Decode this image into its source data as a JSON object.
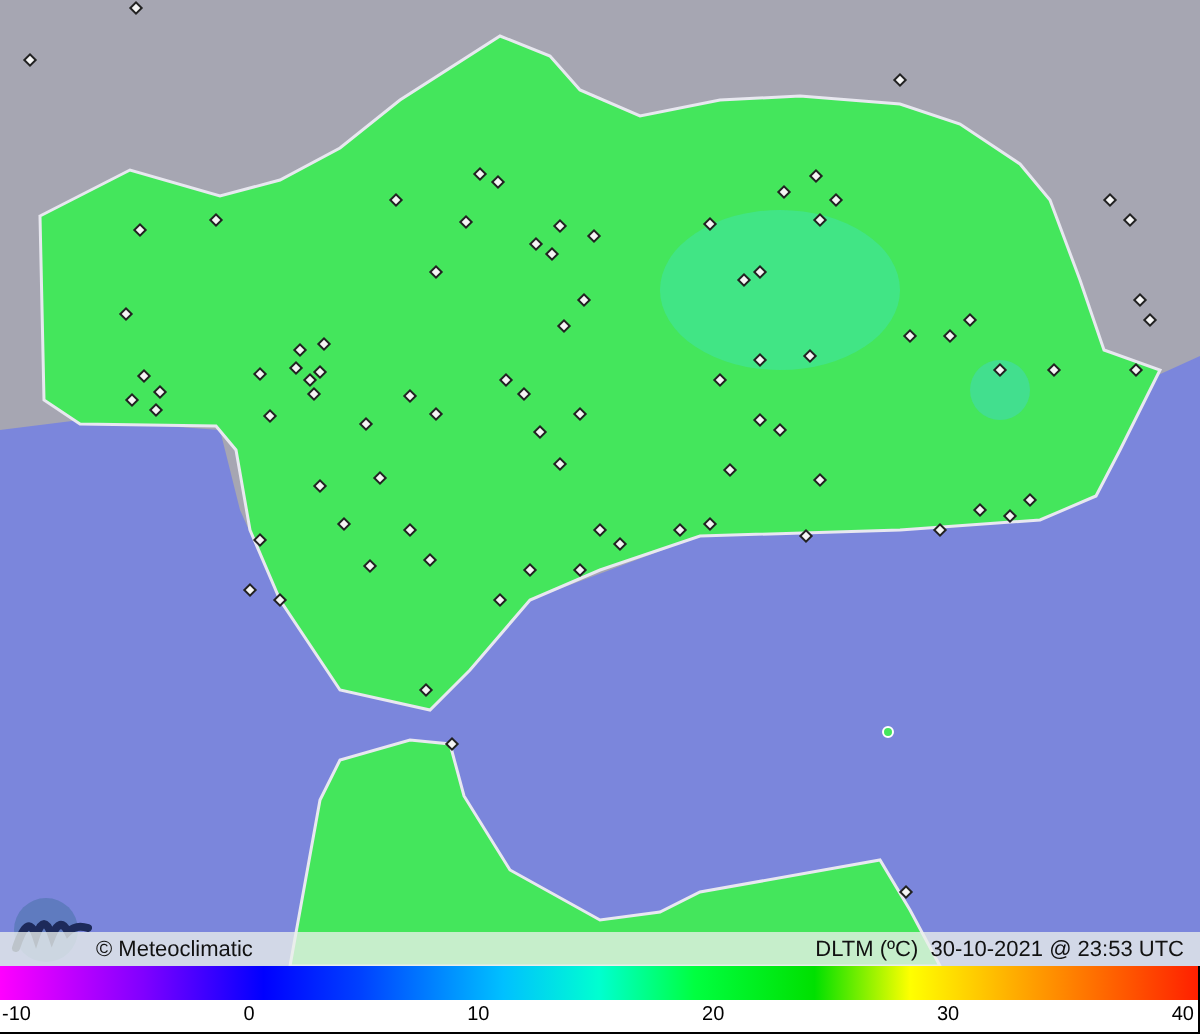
{
  "map": {
    "credit": "© Meteoclimatic",
    "caption": "DLTM (ºC)  30-10-2021 @ 23:53 UTC"
  },
  "scale": {
    "ticks": [
      "-10",
      "0",
      "10",
      "20",
      "30",
      "40"
    ]
  }
}
